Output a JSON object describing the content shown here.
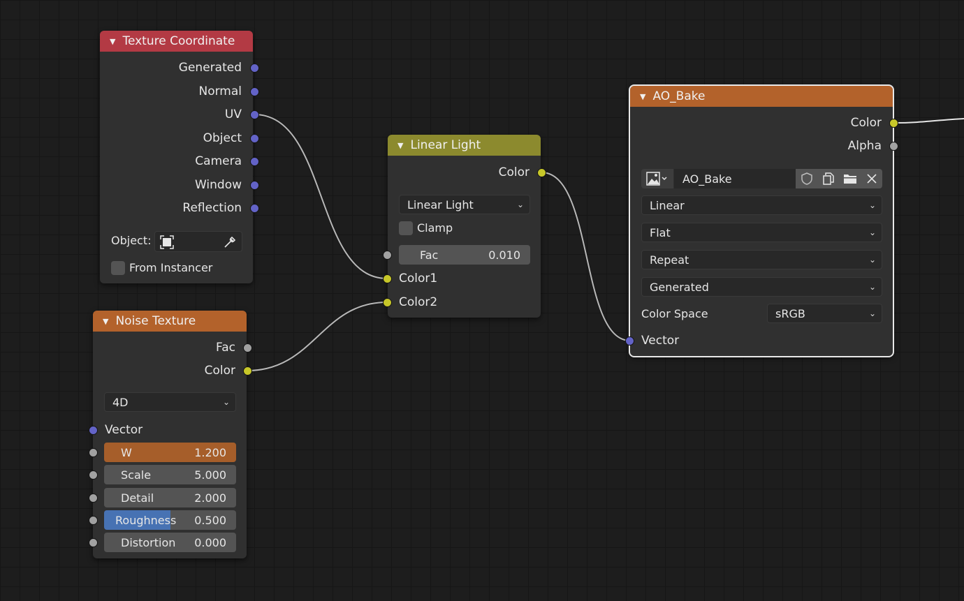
{
  "texture_coordinate": {
    "title": "Texture Coordinate",
    "outputs": [
      "Generated",
      "Normal",
      "UV",
      "Object",
      "Camera",
      "Window",
      "Reflection"
    ],
    "object_label": "Object:",
    "from_instancer_label": "From Instancer",
    "header_color": "#b33a44"
  },
  "noise_texture": {
    "title": "Noise Texture",
    "outputs": [
      "Fac",
      "Color"
    ],
    "dimensions": "4D",
    "vector_label": "Vector",
    "fields": [
      {
        "label": "W",
        "value": "1.200"
      },
      {
        "label": "Scale",
        "value": "5.000"
      },
      {
        "label": "Detail",
        "value": "2.000"
      },
      {
        "label": "Roughness",
        "value": "0.500",
        "fill_fraction": 0.5
      },
      {
        "label": "Distortion",
        "value": "0.000"
      }
    ],
    "header_color": "#b3622b"
  },
  "linear_light": {
    "title": "Linear Light",
    "output": "Color",
    "blend_mode": "Linear Light",
    "clamp_label": "Clamp",
    "fac_label": "Fac",
    "fac_value": "0.010",
    "inputs": [
      "Color1",
      "Color2"
    ],
    "header_color": "#8c8a2e"
  },
  "ao_bake": {
    "title": "AO_Bake",
    "outputs": [
      "Color",
      "Alpha"
    ],
    "image_name": "AO_Bake",
    "interpolation": "Linear",
    "projection": "Flat",
    "extension": "Repeat",
    "source": "Generated",
    "color_space_label": "Color Space",
    "color_space": "sRGB",
    "vector_label": "Vector",
    "header_color": "#b3622b"
  }
}
